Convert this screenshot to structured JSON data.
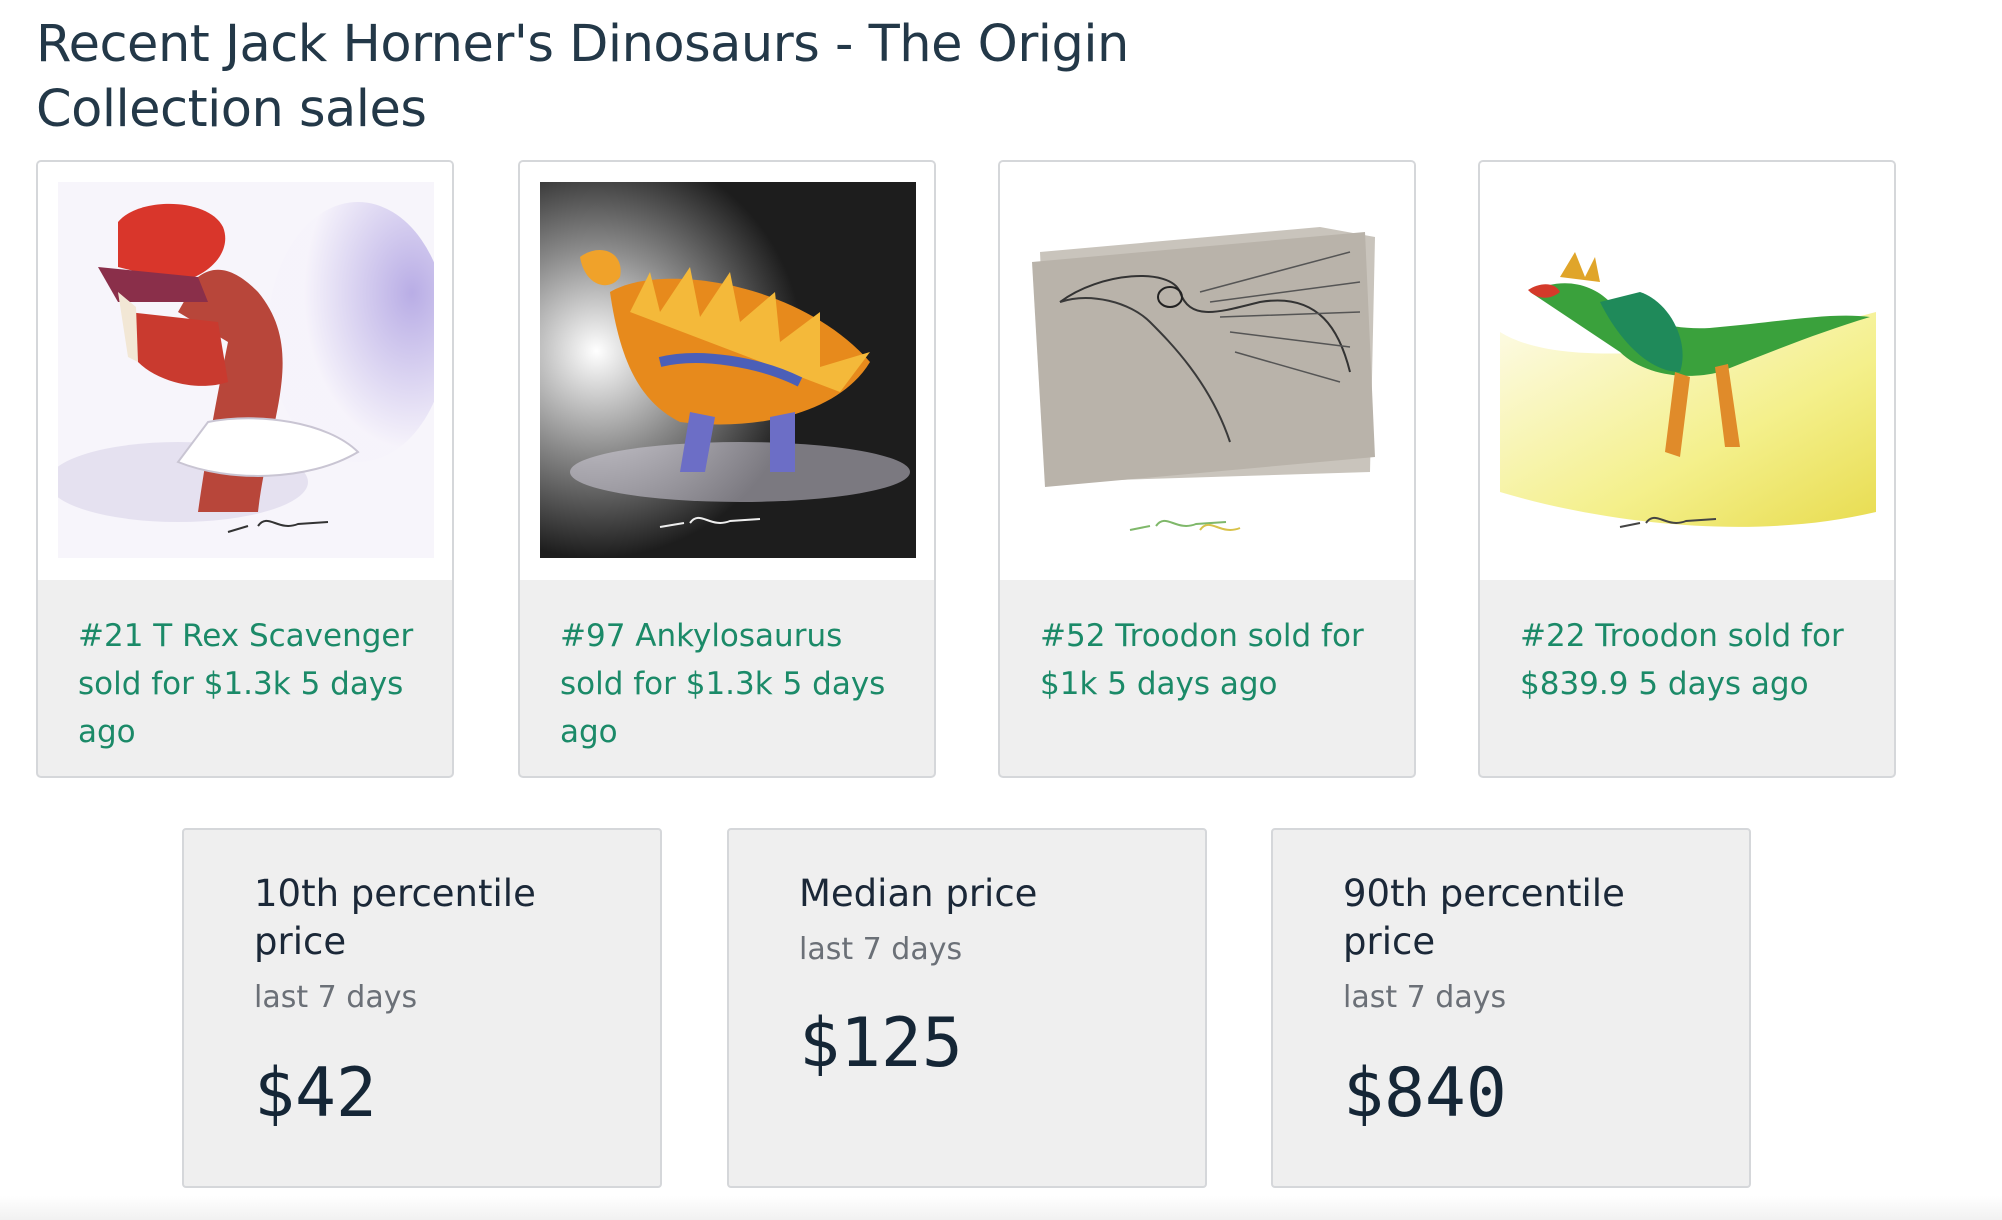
{
  "page": {
    "title": "Recent Jack Horner's Dinosaurs - The Origin Collection sales"
  },
  "sales": [
    {
      "caption": "#21 T Rex Scavenger sold for $1.3k 5 days ago",
      "image": "t-rex-scavenger-illustration"
    },
    {
      "caption": "#97 Ankylosaurus sold for $1.3k 5 days ago",
      "image": "ankylosaurus-illustration"
    },
    {
      "caption": "#52 Troodon sold for $1k 5 days ago",
      "image": "troodon-sketch-illustration"
    },
    {
      "caption": "#22 Troodon sold for $839.9 5 days ago",
      "image": "troodon-color-illustration"
    }
  ],
  "stats": [
    {
      "label": "10th percentile price",
      "period": "last 7 days",
      "value": "$42"
    },
    {
      "label": "Median price",
      "period": "last 7 days",
      "value": "$125"
    },
    {
      "label": "90th percentile price",
      "period": "last 7 days",
      "value": "$840"
    }
  ],
  "colors": {
    "link": "#1b8a68",
    "card_background": "#efefef",
    "title": "#233848"
  }
}
